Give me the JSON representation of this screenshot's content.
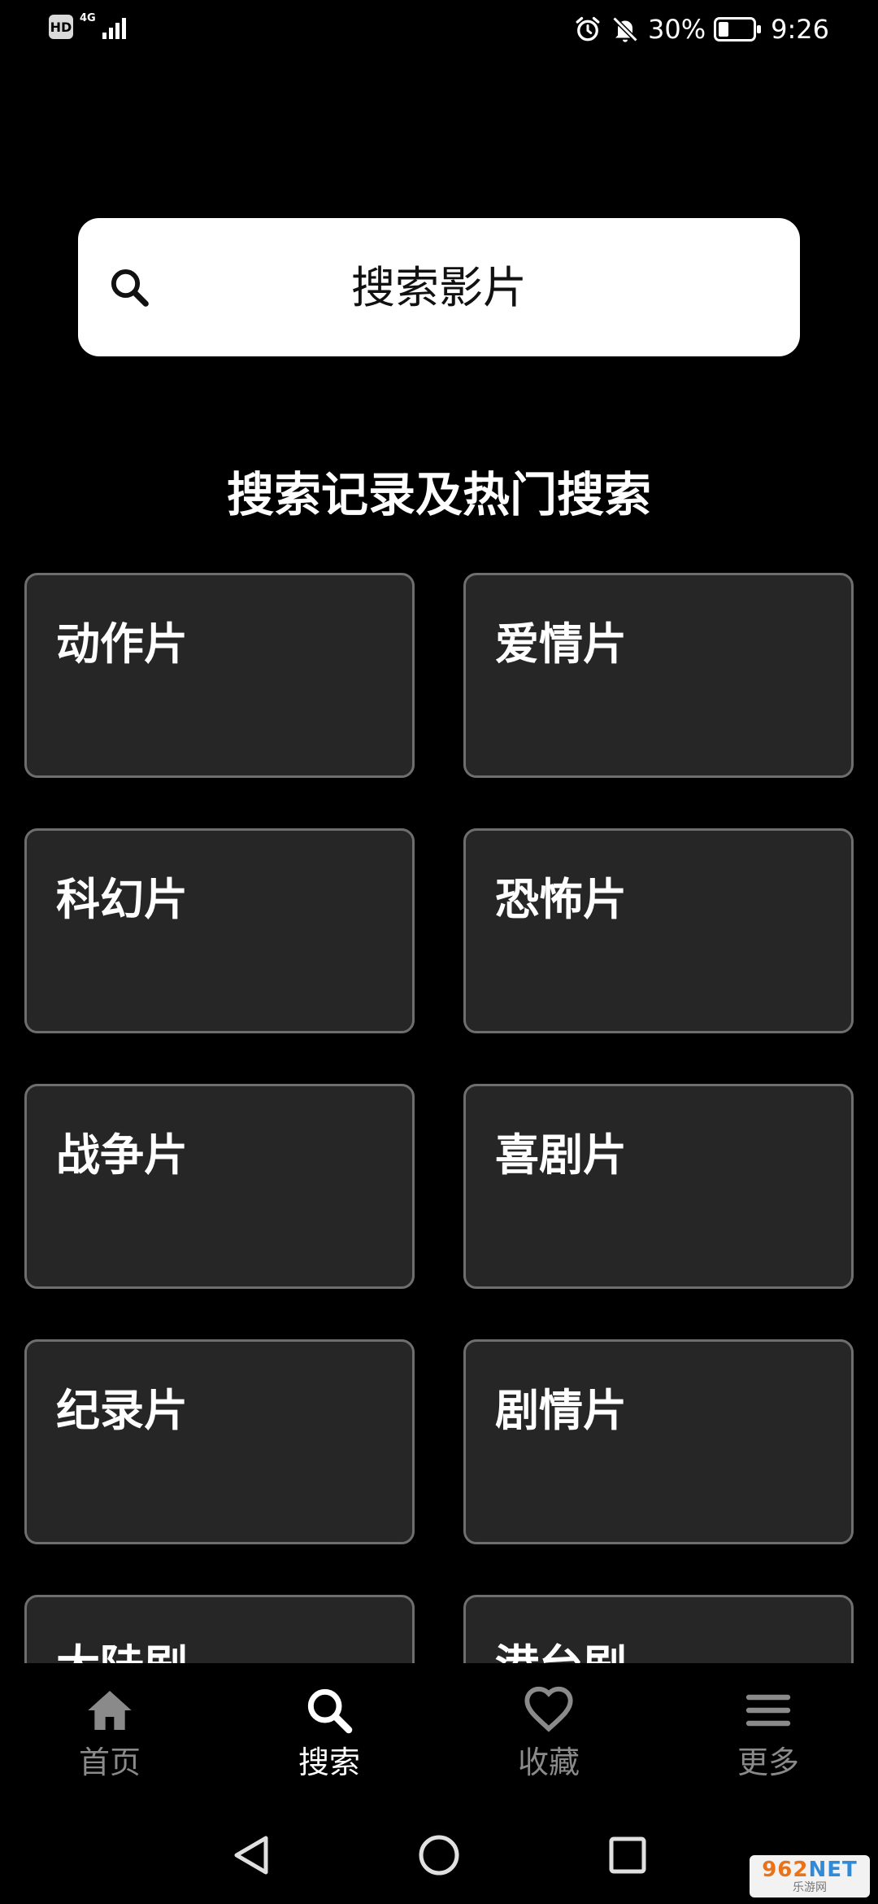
{
  "status_bar": {
    "hd": "HD",
    "network": "4G",
    "battery_percent": "30%",
    "battery_level": 0.3,
    "time": "9:26",
    "icons": [
      "alarm-icon",
      "mute-icon",
      "battery-icon"
    ]
  },
  "search": {
    "placeholder": "搜索影片",
    "icon": "search-icon"
  },
  "section_title": "搜索记录及热门搜索",
  "categories": [
    {
      "label": "动作片"
    },
    {
      "label": "爱情片"
    },
    {
      "label": "科幻片"
    },
    {
      "label": "恐怖片"
    },
    {
      "label": "战争片"
    },
    {
      "label": "喜剧片"
    },
    {
      "label": "纪录片"
    },
    {
      "label": "剧情片"
    },
    {
      "label": "大陆剧"
    },
    {
      "label": "港台剧"
    }
  ],
  "bottom_nav": {
    "items": [
      {
        "label": "首页",
        "icon": "home-icon"
      },
      {
        "label": "搜索",
        "icon": "search-icon",
        "active": true
      },
      {
        "label": "收藏",
        "icon": "heart-icon"
      },
      {
        "label": "更多",
        "icon": "menu-icon"
      }
    ]
  },
  "watermark": {
    "main": "962",
    "suffix": "NET",
    "sub": "乐游网"
  },
  "colors": {
    "background": "#000000",
    "card_bg": "#262626",
    "card_border": "#6e6e6e",
    "nav_inactive": "#8a8a8a",
    "nav_active": "#ffffff"
  }
}
